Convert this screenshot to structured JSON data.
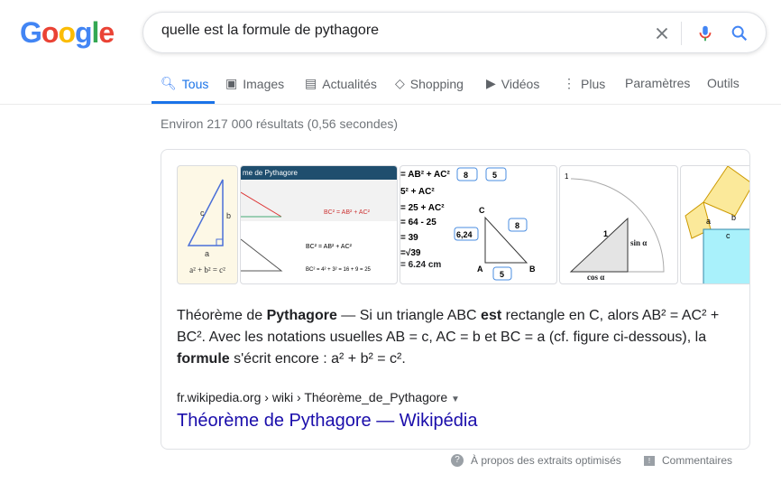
{
  "logo": "Google",
  "search": {
    "query": "quelle est la formule de pythagore"
  },
  "tabs": [
    {
      "label": "Tous",
      "icon": "search-icon"
    },
    {
      "label": "Images",
      "icon": "image-icon"
    },
    {
      "label": "Actualités",
      "icon": "news-icon"
    },
    {
      "label": "Shopping",
      "icon": "tag-icon"
    },
    {
      "label": "Vidéos",
      "icon": "play-icon"
    },
    {
      "label": "Plus",
      "icon": "more-vert-icon"
    }
  ],
  "tools": {
    "settings": "Paramètres",
    "tools": "Outils"
  },
  "stats": "Environ 217 000 résultats (0,56 secondes)",
  "thumbs": {
    "t1_formula": "a² + b² = c²",
    "t2_title": "me de Pythagore",
    "t3_result": "= 6.24 cm",
    "t4_cos": "cos α",
    "t4_sin": "sin α"
  },
  "snippet": {
    "p1": "Théorème de ",
    "b1": "Pythagore",
    "p2": " — Si un triangle ABC ",
    "b2": "est",
    "p3": " rectangle en C, alors AB² = AC² + BC². Avec les notations usuelles AB = c, AC = b et BC = a (cf. figure ci-dessous), la ",
    "b3": "formule",
    "p4": " s'écrit encore : a² + b² = c²."
  },
  "result": {
    "cite": "fr.wikipedia.org › wiki › Théorème_de_Pythagore",
    "title": "Théorème de Pythagore — Wikipédia"
  },
  "footer": {
    "about": "À propos des extraits optimisés",
    "feedback": "Commentaires"
  },
  "colors": {
    "accent": "#1a73e8",
    "link": "#1a0dab"
  }
}
